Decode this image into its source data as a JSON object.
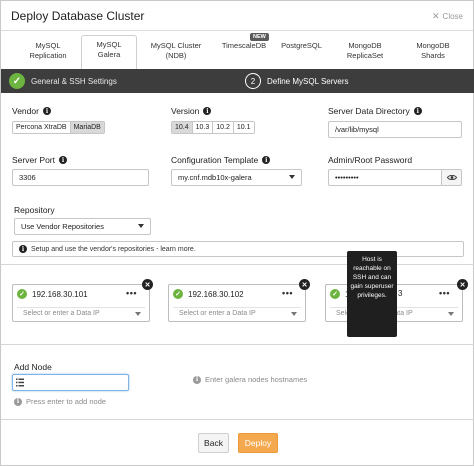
{
  "window": {
    "title": "Deploy Database Cluster",
    "close_label": "Close"
  },
  "tabs": [
    {
      "label_1": "MySQL",
      "label_2": "Replication"
    },
    {
      "label_1": "MySQL",
      "label_2": "Galera"
    },
    {
      "label_1": "MySQL Cluster",
      "label_2": "(NDB)"
    },
    {
      "label_1": "TimescaleDB",
      "label_2": ""
    },
    {
      "label_1": "PostgreSQL",
      "label_2": ""
    },
    {
      "label_1": "MongoDB",
      "label_2": "ReplicaSet"
    },
    {
      "label_1": "MongoDB",
      "label_2": "Shards"
    }
  ],
  "new_badge": "NEW",
  "steps": {
    "step1": "General & SSH Settings",
    "step2_number": "2",
    "step2": "Define MySQL Servers"
  },
  "vendor": {
    "label": "Vendor",
    "options": [
      "Percona XtraDB",
      "MariaDB"
    ]
  },
  "version": {
    "label": "Version",
    "options": [
      "10.4",
      "10.3",
      "10.2",
      "10.1"
    ]
  },
  "data_dir": {
    "label": "Server Data Directory",
    "value": "/var/lib/mysql"
  },
  "server_port": {
    "label": "Server Port",
    "value": "3306"
  },
  "config_template": {
    "label": "Configuration Template",
    "value": "my.cnf.mdb10x-galera"
  },
  "admin_password": {
    "label": "Admin/Root Password",
    "value": "•••••••••"
  },
  "repository": {
    "label": "Repository",
    "value": "Use Vendor Repositories",
    "notice": "Setup and use the vendor's repositories - learn more."
  },
  "nodes": [
    {
      "ip": "192.168.30.101",
      "menu": "•••",
      "data_placeholder": "Select or enter a Data IP"
    },
    {
      "ip": "192.168.30.102",
      "menu": "•••",
      "data_placeholder": "Select or enter a Data IP"
    },
    {
      "ip": "1",
      "ip_tail": "3",
      "menu": "•••",
      "data_placeholder": "Select or enter a Data IP"
    }
  ],
  "tooltip": {
    "text": "Host is reachable on SSH and can gain superuser privileges."
  },
  "add_node": {
    "label": "Add Node",
    "hostnames_hint": "Enter galera nodes hostnames",
    "enter_hint": "Press enter to add node"
  },
  "buttons": {
    "back": "Back",
    "deploy": "Deploy"
  },
  "colors": {
    "accent_orange": "#f5a94f",
    "success_green": "#6cb33f",
    "step_bar": "#3d3d3d"
  }
}
